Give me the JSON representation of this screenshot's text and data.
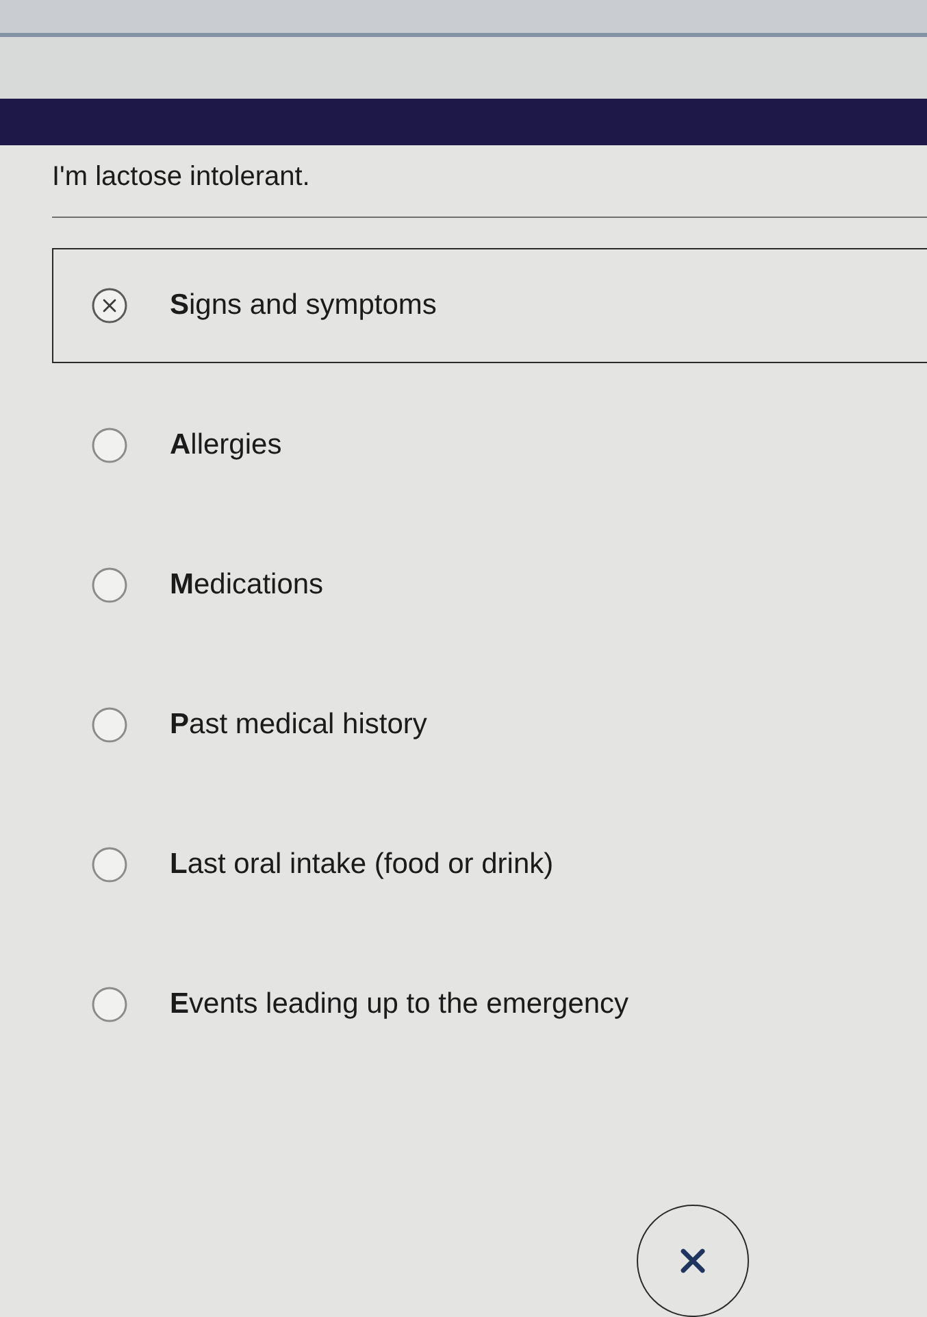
{
  "prompt": "I'm lactose intolerant.",
  "options": [
    {
      "label": "**S**igns and symptoms",
      "selected": true
    },
    {
      "label": "**A**llergies",
      "selected": false
    },
    {
      "label": "**M**edications",
      "selected": false
    },
    {
      "label": "**P**ast medical history",
      "selected": false
    },
    {
      "label": "**L**ast oral intake (food or drink)",
      "selected": false
    },
    {
      "label": "**E**vents leading up to the emergency",
      "selected": false
    }
  ]
}
